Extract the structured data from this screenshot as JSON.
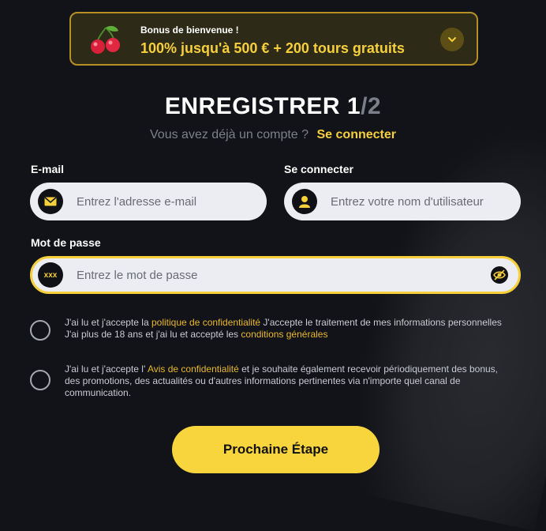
{
  "bonus": {
    "title": "Bonus de bienvenue !",
    "text": "100% jusqu'à 500 € + 200 tours gratuits"
  },
  "register": {
    "title": "ENREGISTRER",
    "step_current": "1",
    "step_total": "/2",
    "have_account": "Vous avez déjà un compte ?",
    "login_link": "Se connecter"
  },
  "form": {
    "email_label": "E-mail",
    "email_placeholder": "Entrez l'adresse e-mail",
    "username_label": "Se connecter",
    "username_placeholder": "Entrez votre nom d'utilisateur",
    "password_label": "Mot de passe",
    "password_placeholder": "Entrez le mot de passe",
    "password_icon_text": "xxx"
  },
  "consents": [
    {
      "pre": "J'ai lu et j'accepte la ",
      "link1": "politique de confidentialité",
      "mid": "  J'accepte le traitement de mes informations personnelles J'ai plus de 18 ans et j'ai lu et accepté les ",
      "link2": "conditions générales",
      "post": ""
    },
    {
      "pre": "J'ai lu et j'accepte l' ",
      "link1": "Avis de confidentialité",
      "mid": " et je souhaite également recevoir périodiquement des bonus, des promotions, des actualités ou d'autres informations pertinentes via n'importe quel canal de communication.",
      "link2": "",
      "post": ""
    }
  ],
  "next_button": "Prochaine Étape",
  "colors": {
    "accent": "#f7cf3b",
    "background": "#111318",
    "input_bg": "#ecedf2"
  },
  "icons": {
    "bonus": "cherry-icon",
    "bonus_toggle": "chevron-down-icon",
    "email": "envelope-icon",
    "username": "user-icon",
    "password": "password-mask-icon",
    "toggle_visibility": "eye-slash-icon"
  }
}
